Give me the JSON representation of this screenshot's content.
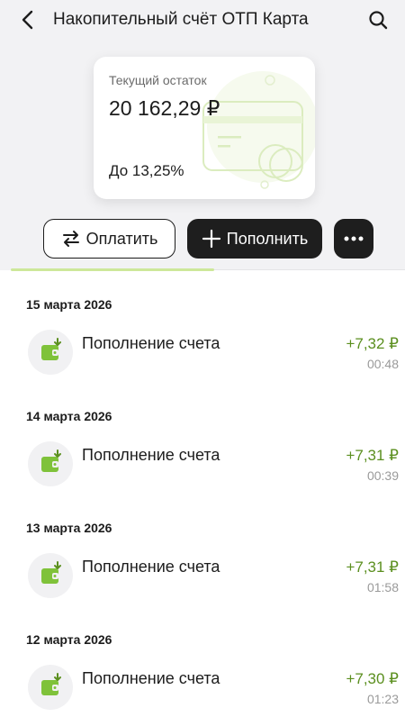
{
  "header": {
    "title": "Накопительный счёт ОТП Карта",
    "back_icon": "chevron-left-icon",
    "search_icon": "search-icon"
  },
  "card": {
    "label": "Текущий остаток",
    "amount": "20 162,29 ₽",
    "rate": "До 13,25%"
  },
  "actions": {
    "pay_label": "Оплатить",
    "topup_label": "Пополнить",
    "more_label": "•••"
  },
  "transactions": [
    {
      "date": "15 марта 2026",
      "title": "Пополнение счета",
      "amount": "+7,32 ₽",
      "time": "00:48"
    },
    {
      "date": "14 марта 2026",
      "title": "Пополнение счета",
      "amount": "+7,31 ₽",
      "time": "00:39"
    },
    {
      "date": "13 марта 2026",
      "title": "Пополнение счета",
      "amount": "+7,31 ₽",
      "time": "01:58"
    },
    {
      "date": "12 марта 2026",
      "title": "Пополнение счета",
      "amount": "+7,30 ₽",
      "time": "01:23"
    }
  ],
  "colors": {
    "accent_green": "#5b8f1f",
    "primary_dark": "#1e1e1e",
    "background_top": "#f2f2f4"
  }
}
